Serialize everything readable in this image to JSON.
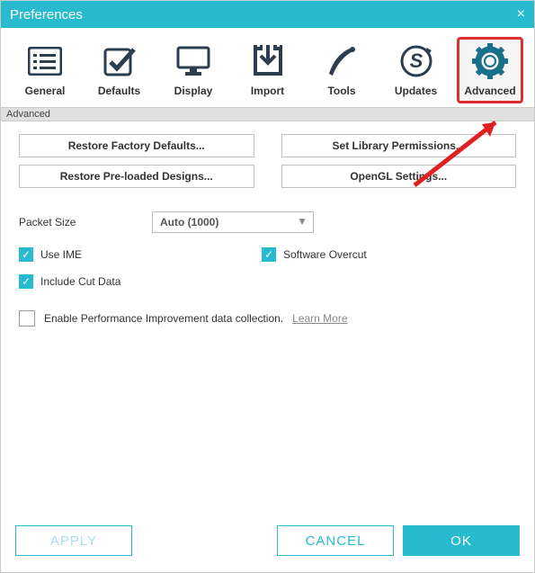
{
  "title": "Preferences",
  "tabs": [
    {
      "label": "General"
    },
    {
      "label": "Defaults"
    },
    {
      "label": "Display"
    },
    {
      "label": "Import"
    },
    {
      "label": "Tools"
    },
    {
      "label": "Updates"
    },
    {
      "label": "Advanced"
    }
  ],
  "section_label": "Advanced",
  "buttons": {
    "restore_defaults": "Restore Factory Defaults...",
    "set_library": "Set Library Permissions...",
    "restore_designs": "Restore Pre-loaded Designs...",
    "opengl": "OpenGL Settings..."
  },
  "packet_size": {
    "label": "Packet Size",
    "value": "Auto (1000)"
  },
  "checks": {
    "use_ime": "Use IME",
    "software_overcut": "Software Overcut",
    "include_cut": "Include Cut Data",
    "perf": "Enable Performance Improvement data collection.",
    "learn_more": "Learn More"
  },
  "footer": {
    "apply": "APPLY",
    "cancel": "CANCEL",
    "ok": "OK"
  }
}
